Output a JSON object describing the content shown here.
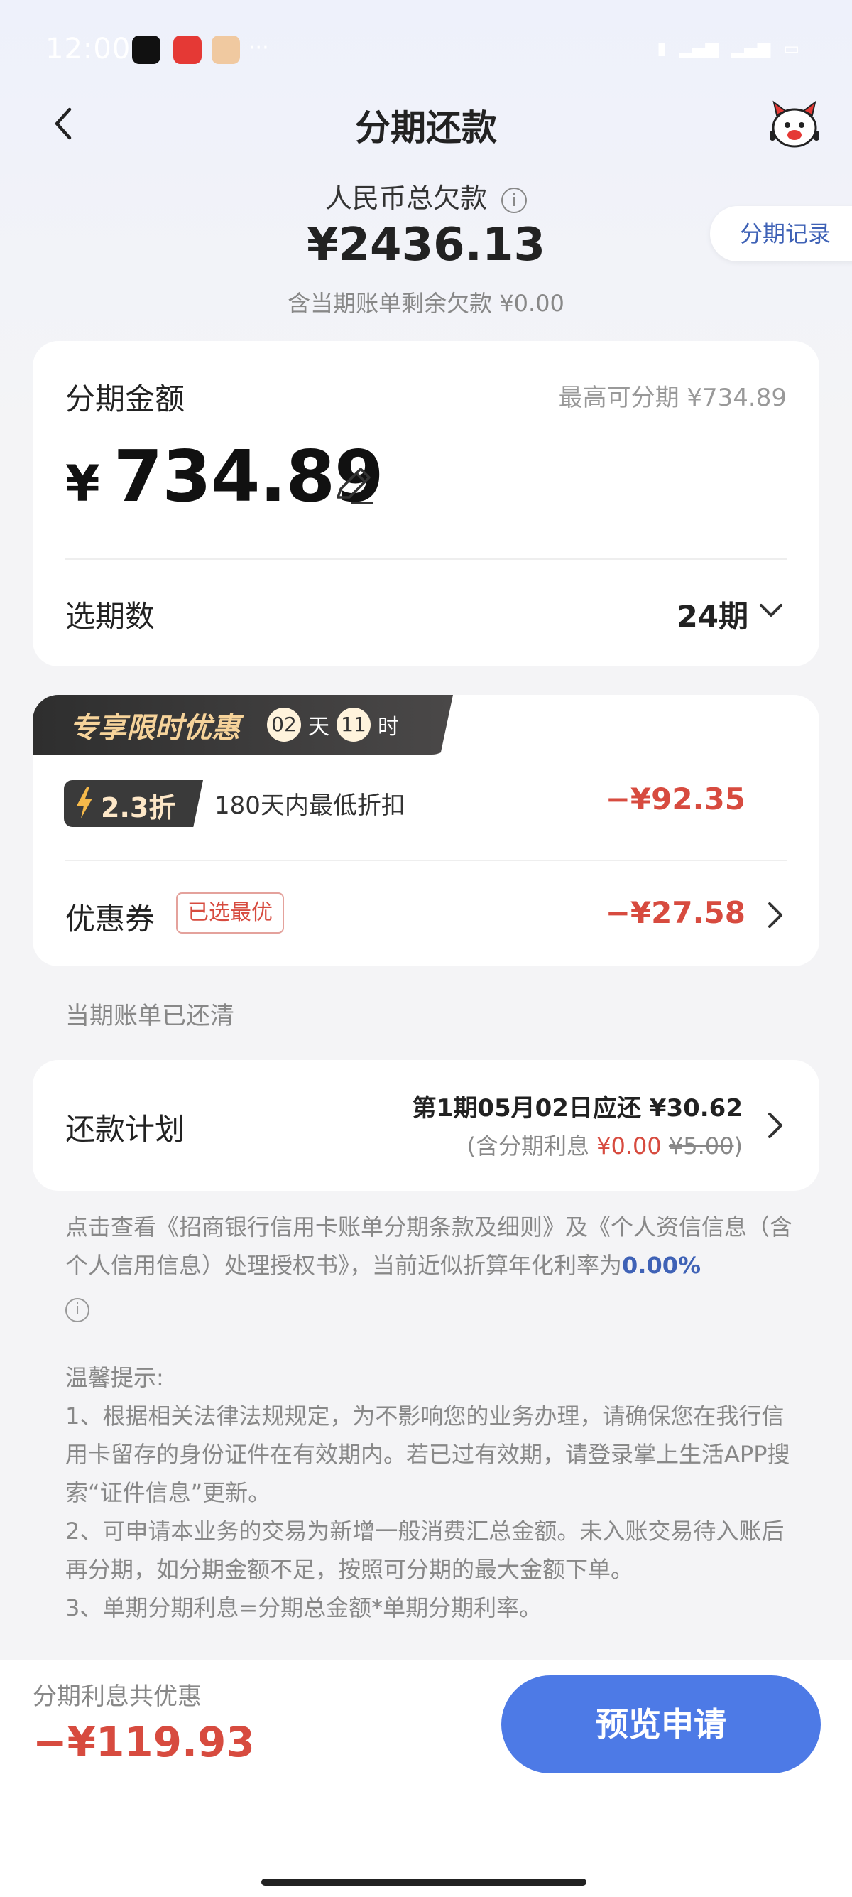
{
  "status_bar": {
    "time": "12:00",
    "icons": [
      "network-speed-icon",
      "5g-signal-icon",
      "5g-signal-icon",
      "battery-icon"
    ]
  },
  "header": {
    "title": "分期还款",
    "back_icon": "chevron-left-icon",
    "mascot_icon": "mascot-icon"
  },
  "summary": {
    "label": "人民币总欠款",
    "amount": "¥2436.13",
    "sub": "含当期账单剩余欠款 ¥0.00",
    "record_button": "分期记录"
  },
  "installment": {
    "label": "分期金额",
    "max_label": "最高可分期 ¥734.89",
    "currency": "¥",
    "amount": "734.89",
    "period_label": "选期数",
    "period_value": "24期"
  },
  "promotion": {
    "banner_title": "专享限时优惠",
    "days": "02",
    "days_unit": "天",
    "hours": "11",
    "hours_unit": "时",
    "discount_badge": "2.3折",
    "discount_desc": "180天内最低折扣",
    "discount_amount": "−¥92.35",
    "coupon_label": "优惠券",
    "coupon_tag": "已选最优",
    "coupon_amount": "−¥27.58"
  },
  "bill_status": "当期账单已还清",
  "plan": {
    "label": "还款计划",
    "line1": "第1期05月02日应还 ¥30.62",
    "line2_prefix": "(含分期利息 ",
    "line2_interest": "¥0.00",
    "line2_original": "¥5.00",
    "line2_suffix": ")"
  },
  "agreement": {
    "text": "点击查看《招商银行信用卡账单分期条款及细则》及《个人资信信息（含个人信用信息）处理授权书》，当前近似折算年化利率为",
    "rate": "0.00%"
  },
  "tips": {
    "title": "温馨提示:",
    "items": [
      "1、根据相关法律法规规定，为不影响您的业务办理，请确保您在我行信用卡留存的身份证件在有效期内。若已过有效期，请登录掌上生活APP搜索“证件信息”更新。",
      "2、可申请本业务的交易为新增一般消费汇总金额。未入账交易待入账后再分期，如分期金额不足，按照可分期的最大金额下单。",
      "3、单期分期利息=分期总金额*单期分期利率。"
    ]
  },
  "footer": {
    "save_label": "分期利息共优惠",
    "save_amount": "−¥119.93",
    "apply_button": "预览申请"
  },
  "colors": {
    "accent_blue": "#4d7ae6",
    "link_blue": "#3f62b6",
    "discount_red": "#d74b3f",
    "promo_gold": "#f6d39a"
  }
}
